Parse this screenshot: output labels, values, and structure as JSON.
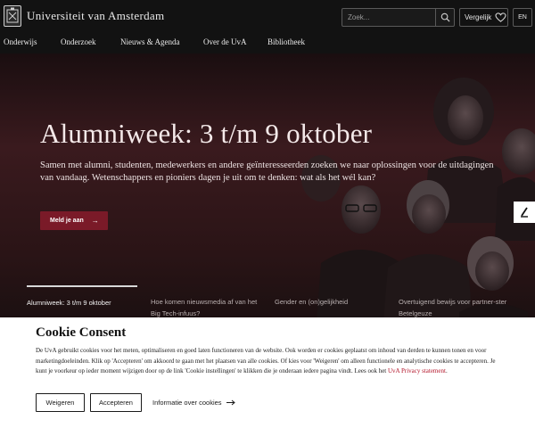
{
  "header": {
    "logo_text": "Universiteit van Amsterdam",
    "search_placeholder": "Zoek...",
    "compare_label": "Vergelijk",
    "lang_label": "EN"
  },
  "nav": {
    "items": [
      "Onderwijs",
      "Onderzoek",
      "Nieuws & Agenda",
      "Over de UvA",
      "Bibliotheek"
    ]
  },
  "hero": {
    "title": "Alumniweek: 3 t/m 9 oktober",
    "text": "Samen met alumni, studenten, medewerkers en andere geïnteresseerden zoeken we naar oplossingen voor de uitdagingen van vandaag. Wetenschappers en pioniers dagen je uit om te denken: wat als het wél kan?",
    "button_label": "Meld je aan",
    "button_arrow": "→",
    "side_toggle": "⁄"
  },
  "slides": [
    {
      "label": "Alumniweek: 3 t/m 9 oktober",
      "active": true
    },
    {
      "label": "Hoe komen nieuwsmedia af van het Big Tech-infuus?",
      "active": false
    },
    {
      "label": "Gender en (on)gelijkheid",
      "active": false
    },
    {
      "label": "Overtuigend bewijs voor partner-ster Betelgeuze",
      "active": false
    }
  ],
  "cookie": {
    "title": "Cookie Consent",
    "text_before_link": "De UvA gebruikt cookies voor het meten, optimaliseren en goed laten functioneren van de website. Ook worden er cookies geplaatst om inhoud van derden te kunnen tonen en voor marketingdoeleinden. Klik op 'Accepteren' om akkoord te gaan met het plaatsen van alle cookies. Of kies voor 'Weigeren' om alleen functionele en analytische cookies te accepteren. Je kunt je voorkeur op ieder moment wijzigen door op de link 'Cookie instellingen' te klikken die je onderaan iedere pagina vindt. Lees ook het ",
    "link_text": "UvA Privacy statement",
    "text_after_link": ".",
    "refuse_label": "Weigeren",
    "accept_label": "Accepteren",
    "info_label": "Informatie over cookies"
  },
  "colors": {
    "brand_red": "#7a1a28",
    "link_red": "#b3152a",
    "header_bg": "#121212"
  }
}
